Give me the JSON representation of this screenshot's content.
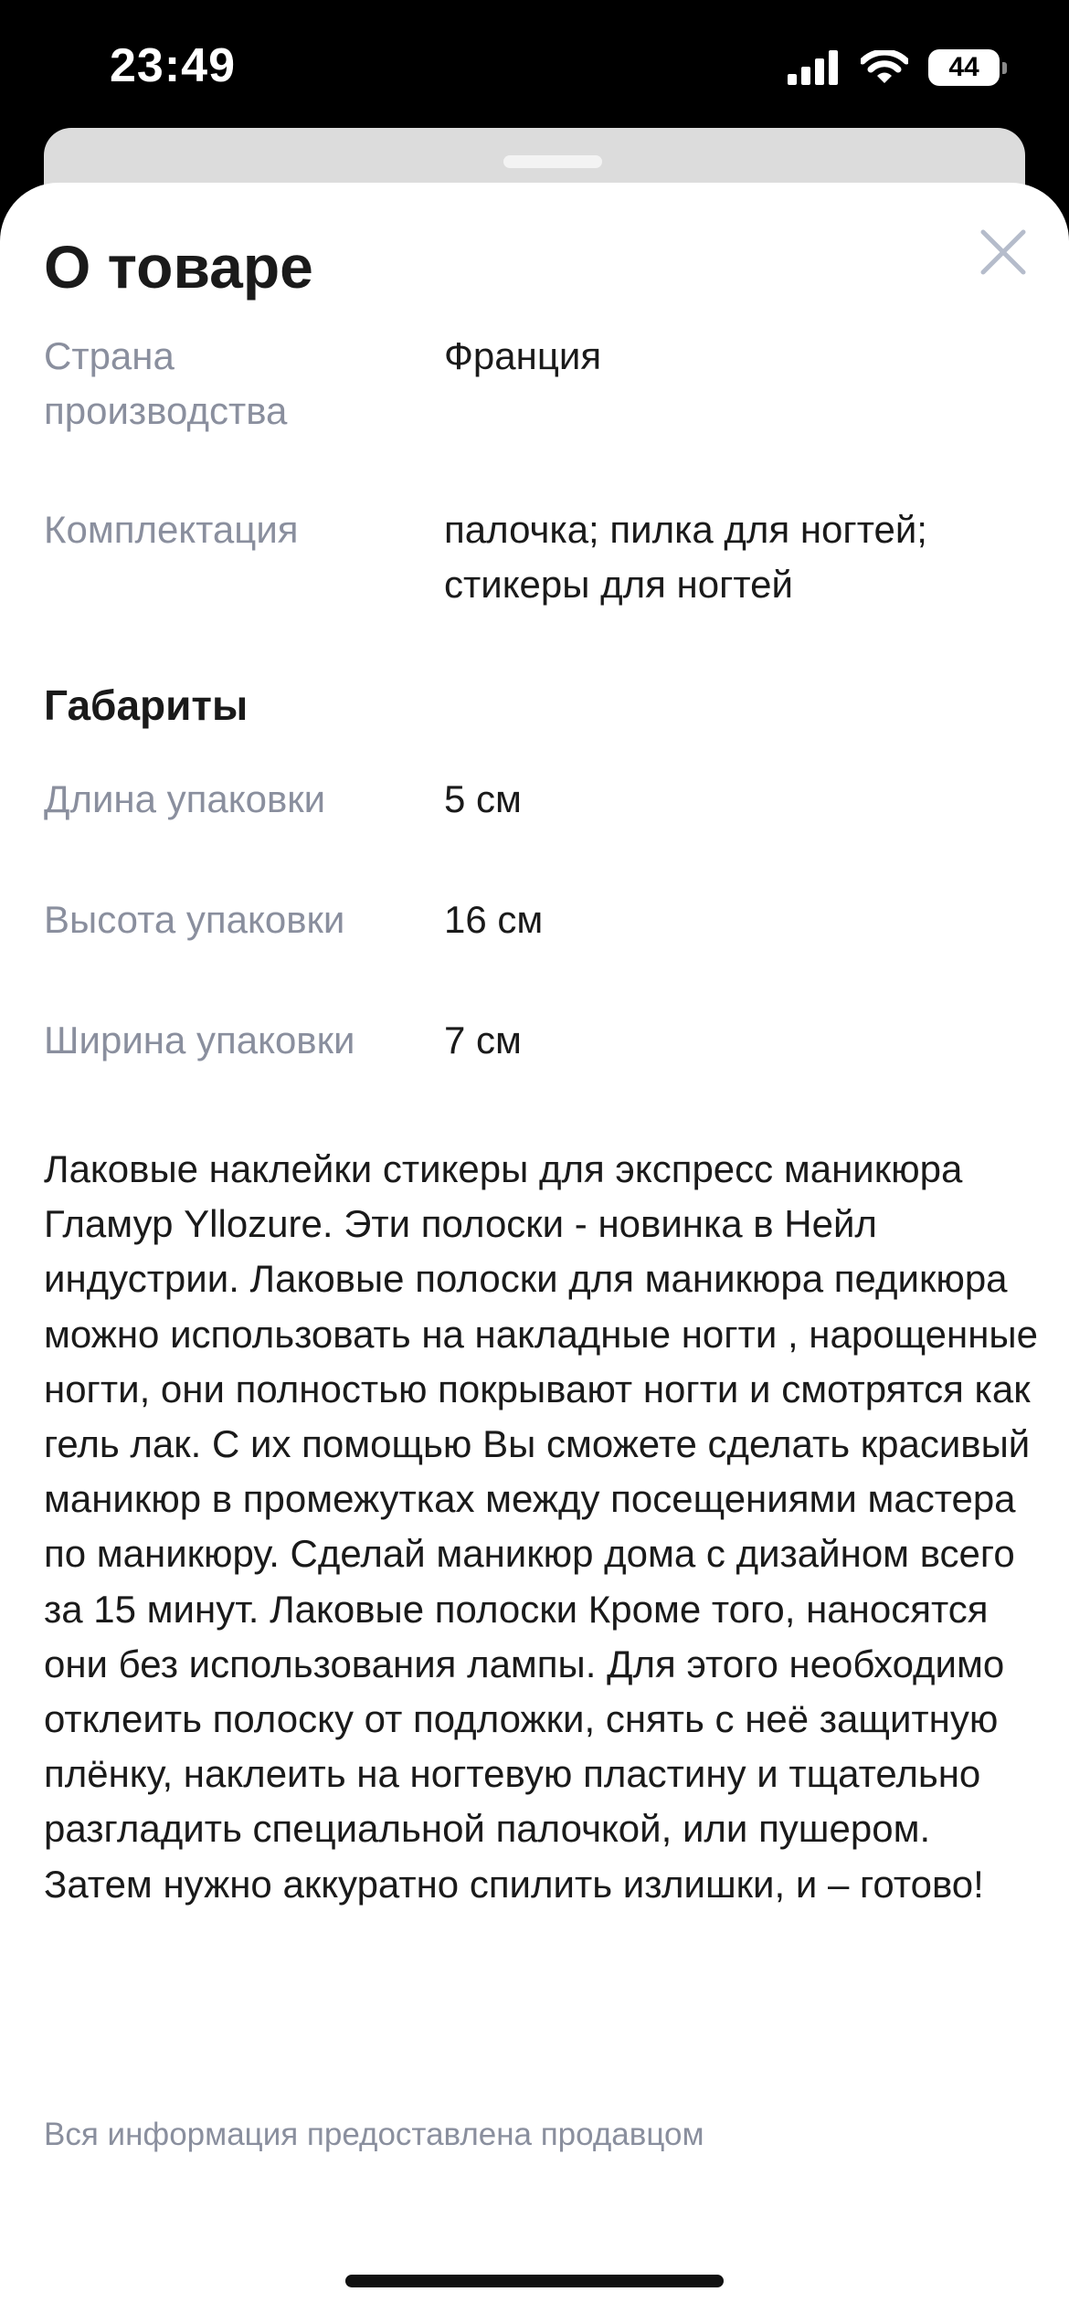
{
  "status_bar": {
    "time": "23:49",
    "battery": "44"
  },
  "sheet": {
    "title": "О товаре",
    "attributes": [
      {
        "label": "Страна производства",
        "value": "Франция"
      },
      {
        "label": "Комплектация",
        "value": "палочка; пилка для ногтей; стикеры для ногтей"
      }
    ],
    "dimensions_title": "Габариты",
    "dimensions": [
      {
        "label": "Длина упаковки",
        "value": "5 см"
      },
      {
        "label": "Высота упаковки",
        "value": "16 см"
      },
      {
        "label": "Ширина упаковки",
        "value": "7 см"
      }
    ],
    "description": "Лаковые наклейки стикеры для экспресс маникюра Гламур Yllozure. Эти полоски - новинка в Нейл индустрии. Лаковые полоски для маникюра педикюра можно использовать на накладные ногти , нарощенные ногти, они полностью покрывают ногти и смотрятся как гель лак. С их помощью Вы сможете сделать красивый маникюр в промежутках между посещениями мастера по маникюру. Сделай маникюр дома с дизайном всего за 15 минут. Лаковые полоски Кроме того, наносятся они без использования лампы. Для этого необходимо отклеить полоску от подложки, снять с неё защитную плёнку, наклеить на ногтевую пластину и тщательно разгладить специальной палочкой, или пушером. Затем нужно аккуратно спилить излишки, и – готово!",
    "footnote": "Вся информация предоставлена продавцом"
  },
  "colors": {
    "label_gray": "#8a8f9e",
    "text_dark": "#1a1a1a",
    "close_icon": "#b5bccb"
  }
}
